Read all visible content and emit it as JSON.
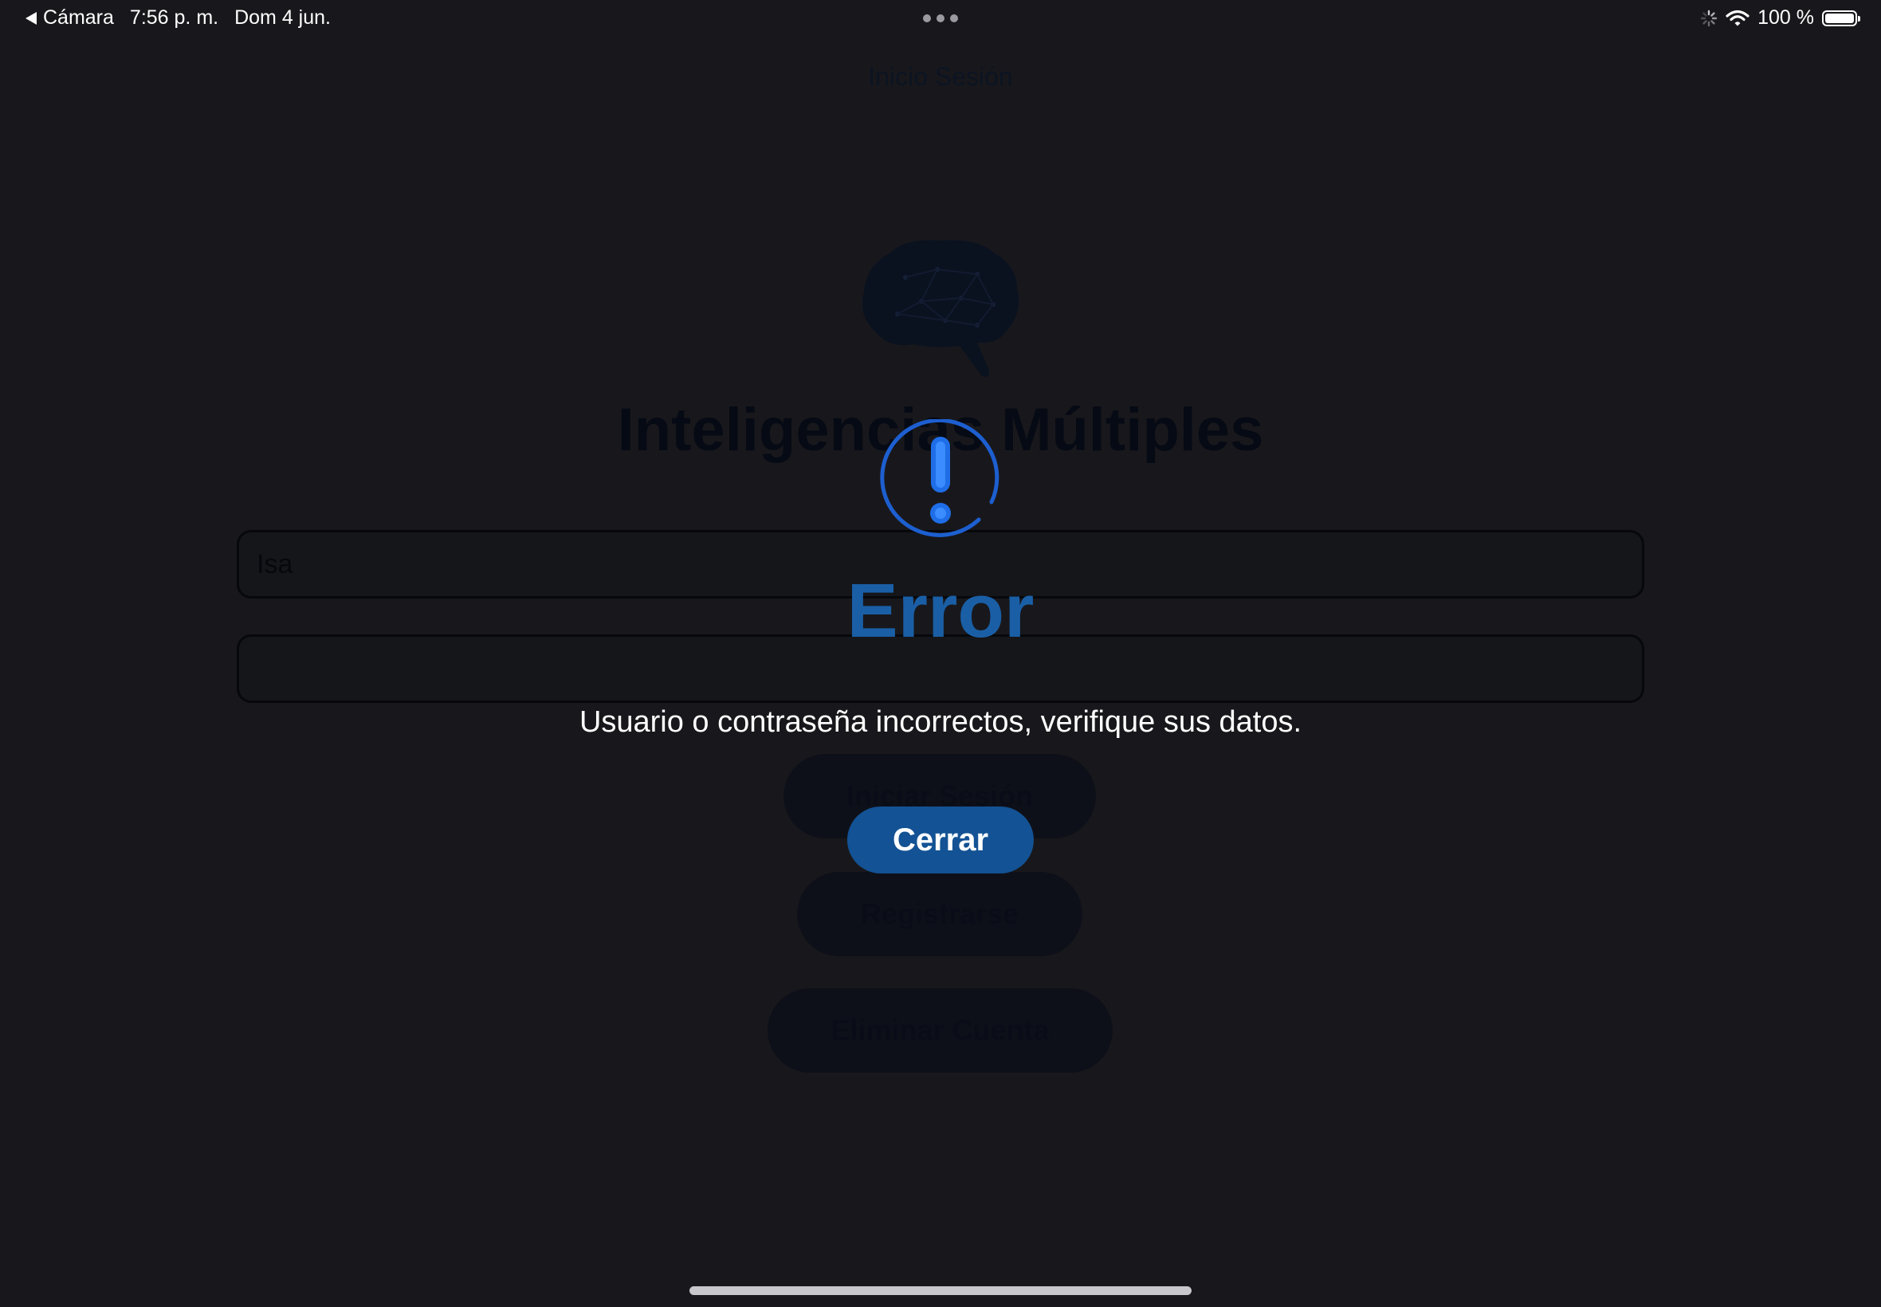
{
  "status_bar": {
    "back_app": "Cámara",
    "time": "7:56 p. m.",
    "date": "Dom 4 jun.",
    "battery": "100 %",
    "icons": [
      "back-arrow-icon",
      "multitask-dots-icon",
      "activity-spinner-icon",
      "wifi-icon",
      "battery-icon"
    ]
  },
  "nav": {
    "title": "Inicio Sesión"
  },
  "login": {
    "logo_icon": "brain-icon",
    "app_title": "Inteligencias Múltiples",
    "username_value": "Isa",
    "password_value": "",
    "login_button": "Iniciar Sesión",
    "register_button": "Registrarse",
    "delete_button": "Eliminar Cuenta"
  },
  "alert": {
    "icon": "exclamation-circle-icon",
    "title": "Error",
    "message": "Usuario o contraseña incorrectos, verifique sus datos.",
    "close_button": "Cerrar"
  },
  "colors": {
    "background": "#18181c",
    "accent": "#135294",
    "alert_title": "#1a5fa6",
    "alert_icon": "#1f6ee8"
  }
}
